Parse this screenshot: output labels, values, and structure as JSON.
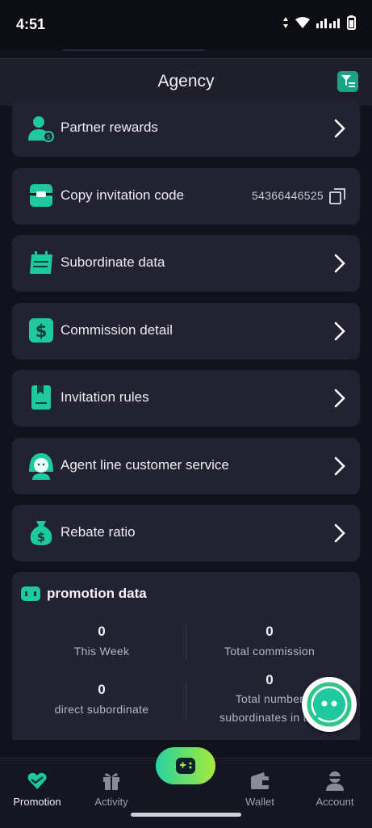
{
  "status_bar": {
    "time": "4:51"
  },
  "header": {
    "title": "Agency"
  },
  "menu": [
    {
      "label": "Partner rewards",
      "icon": "partner-rewards-icon"
    },
    {
      "label": "Copy invitation code",
      "icon": "invitation-code-icon",
      "value": "54366446525"
    },
    {
      "label": "Subordinate data",
      "icon": "subordinate-data-icon"
    },
    {
      "label": "Commission detail",
      "icon": "commission-icon"
    },
    {
      "label": "Invitation rules",
      "icon": "invitation-rules-icon"
    },
    {
      "label": "Agent line customer service",
      "icon": "customer-service-icon"
    },
    {
      "label": "Rebate ratio",
      "icon": "rebate-ratio-icon"
    }
  ],
  "promotion": {
    "title": "promotion data",
    "stats": [
      {
        "value": "0",
        "label": "This Week"
      },
      {
        "value": "0",
        "label": "Total commission"
      },
      {
        "value": "0",
        "label": "direct subordinate"
      },
      {
        "value": "0",
        "label": "Total number of subordinates in the team"
      }
    ],
    "stats_visible_labels": [
      "This Week",
      "Total commission",
      "direct subordinate",
      "Total number",
      "subordinates in the"
    ]
  },
  "tabs": [
    {
      "label": "Promotion",
      "active": true
    },
    {
      "label": "Activity",
      "active": false
    },
    {
      "label": "",
      "active": false
    },
    {
      "label": "Wallet",
      "active": false
    },
    {
      "label": "Account",
      "active": false
    }
  ],
  "colors": {
    "accent": "#1ec9a0",
    "background": "#12121c",
    "card": "#222232"
  }
}
